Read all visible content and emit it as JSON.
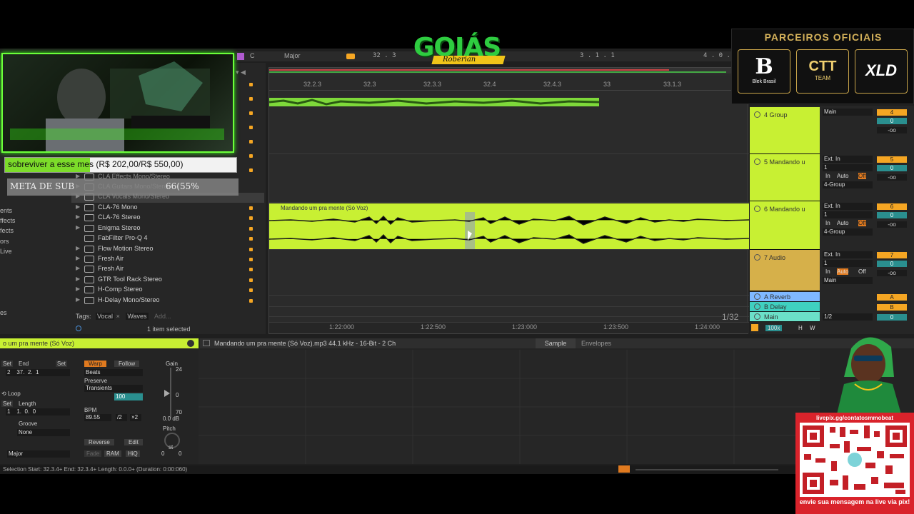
{
  "topbar": {
    "key": "C",
    "scale": "Major",
    "pos1": "32 . 3",
    "pos2": "3 .  1 .  1",
    "pos3": "4 .  0 ."
  },
  "browser": {
    "side_items": [
      "ents",
      "ffects",
      "fects",
      "ors",
      "Live",
      "es"
    ],
    "partial_rows": [
      "CLA Effects Mono/Stereo",
      "CLA Guitars Mono/Stereo",
      "CLA Vocals Mono/Stereo"
    ],
    "plugins": [
      {
        "name": "CLA-76 Mono",
        "expand": true
      },
      {
        "name": "CLA-76 Stereo",
        "expand": true
      },
      {
        "name": "Enigma Stereo",
        "expand": true
      },
      {
        "name": "FabFilter Pro-Q 4",
        "expand": false
      },
      {
        "name": "Flow Motion Stereo",
        "expand": true
      },
      {
        "name": "Fresh Air",
        "expand": true
      },
      {
        "name": "Fresh Air",
        "expand": true
      },
      {
        "name": "GTR Tool Rack Stereo",
        "expand": true
      },
      {
        "name": "H-Comp Stereo",
        "expand": true
      },
      {
        "name": "H-Delay Mono/Stereo",
        "expand": true
      }
    ],
    "tags_label": "Tags:",
    "tag1": "Vocal",
    "tag2": "Waves",
    "tag_add": "Add...",
    "selection_info": "1 item selected"
  },
  "arrangement": {
    "ruler": [
      "32.2.3",
      "32.3",
      "32.3.3",
      "32.4",
      "32.4.3",
      "33",
      "33.1.3"
    ],
    "clip_name": "Mandando um pra mente (Só Voz)",
    "time_ruler": [
      "1:22:000",
      "1:22:500",
      "1:23:000",
      "1:23:500",
      "1:24:000"
    ],
    "zoom": "1/32"
  },
  "mixer": {
    "tracks": [
      {
        "name": "4 Group",
        "input": "Main",
        "number": "4",
        "vol": "0",
        "pan": "-oo"
      },
      {
        "name": "5 Mandando u",
        "input": "Ext. In",
        "channel": "1",
        "number": "5",
        "vol": "0",
        "pan": "-oo",
        "monitor_in": "In",
        "monitor_auto": "Auto",
        "monitor_off": "Off",
        "output": "4-Group"
      },
      {
        "name": "6 Mandando u",
        "input": "Ext. In",
        "channel": "1",
        "number": "6",
        "vol": "0",
        "pan": "-oo",
        "monitor_in": "In",
        "monitor_auto": "Auto",
        "monitor_off": "Off",
        "output": "4-Group"
      },
      {
        "name": "7 Audio",
        "input": "Ext. In",
        "channel": "1",
        "number": "7",
        "vol": "0",
        "pan": "-oo",
        "monitor_in": "In",
        "monitor_auto": "Auto",
        "monitor_off": "Off",
        "output": "Main"
      }
    ],
    "returns": [
      {
        "name": "A Reverb",
        "letter": "A"
      },
      {
        "name": "B Delay",
        "letter": "B"
      },
      {
        "name": "Main",
        "input": "1/2",
        "vol": "0"
      }
    ],
    "zoom": "100x",
    "h": "H",
    "w": "W"
  },
  "detail": {
    "clip_title": "o um pra mente (Só Voz)",
    "file_info": "Mandando um pra mente (Só Voz).mp3  44.1 kHz - 16-Bit - 2 Ch",
    "tab_sample": "Sample",
    "tab_envelopes": "Envelopes",
    "set": "Set",
    "end_label": "End",
    "end_values": [
      "2",
      "37.",
      "2.",
      "1"
    ],
    "loop_label": "Loop",
    "length_label": "Length",
    "length_values": [
      "1",
      "1.",
      "0.",
      "0"
    ],
    "groove_label": "Groove",
    "groove_value": "None",
    "scale_value": "Major",
    "warp": "Warp",
    "follow": "Follow",
    "mode": "Beats",
    "preserve": "Preserve",
    "transients": "Transients",
    "transient_value": "100",
    "bpm_label": "BPM",
    "bpm_value": "89.55",
    "half": "/2",
    "double": "×2",
    "reverse": "Reverse",
    "edit": "Edit",
    "fade": "Fade",
    "ram": "RAM",
    "hiq": "HiQ",
    "gain_label": "Gain",
    "gain_top": "24",
    "gain_mid": "0",
    "gain_bottom": "70",
    "gain_value": "0.0 dB",
    "pitch_label": "Pitch",
    "pitch_unit": "st",
    "pitch_values": [
      "0",
      "0"
    ]
  },
  "status": {
    "text": "Selection   Start: 32.3.4+   End: 32.3.4+   Length: 0.0.0+  (Duration: 0:00:060)"
  },
  "overlay": {
    "goal_text": "sobreviver a esse mes (R$ 202,00/R$ 550,00)",
    "goal_progress": 0.367,
    "meta_label": "META DE SUB",
    "meta_value": "66(55%",
    "logo_text": "GOIÁS",
    "logo_sub": "Roberian",
    "partners_title": "PARCEIROS OFICIAIS",
    "partner1": "B",
    "partner1_sub": "Blek Brasil",
    "partner2": "CTT",
    "partner2_sub": "TEAM",
    "partner3": "XLD",
    "qr_url": "livepix.gg/contatosmmobeat",
    "qr_caption": "envie sua mensagem na live via pix!"
  },
  "colors": {
    "lime": "#c8f033",
    "green_goal": "#7cdc2a",
    "orange": "#f5a623",
    "return_blue": "#7fb8ff",
    "return_teal": "#3fd0c0",
    "qr_red": "#d9232b"
  }
}
